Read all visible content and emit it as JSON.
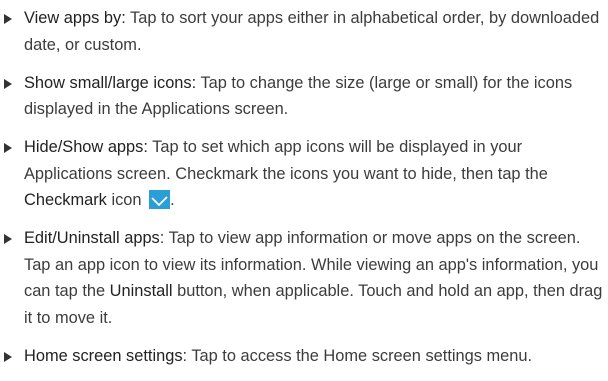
{
  "items": [
    {
      "term": "View apps by:",
      "text": " Tap to sort your apps either in alphabetical order, by downloaded date, or custom."
    },
    {
      "term": "Show small/large icons:",
      "text": " Tap to change the size (large or small) for the icons displayed in the Applications screen."
    },
    {
      "term": "Hide/Show apps:",
      "text": " Tap to set which app icons will be displayed in your Applications screen. Checkmark the icons you want to hide, then tap the ",
      "term2": "Checkmark",
      "text2": " icon ",
      "icon": "checkmark-icon",
      "text3": "."
    },
    {
      "term": "Edit/Uninstall apps",
      "text": ": Tap to view app information or move apps on the screen. Tap an app icon to view its information. While viewing an app's information, you can tap the ",
      "term2": "Uninstall",
      "text2": " button, when applicable. Touch and hold an app, then drag it to move it."
    },
    {
      "term": "Home screen settings",
      "text": ": Tap to access the Home screen settings menu."
    }
  ],
  "colors": {
    "text": "#3c3c3c",
    "bullet": "#333333",
    "icon_bg": "#2a9fd6"
  }
}
